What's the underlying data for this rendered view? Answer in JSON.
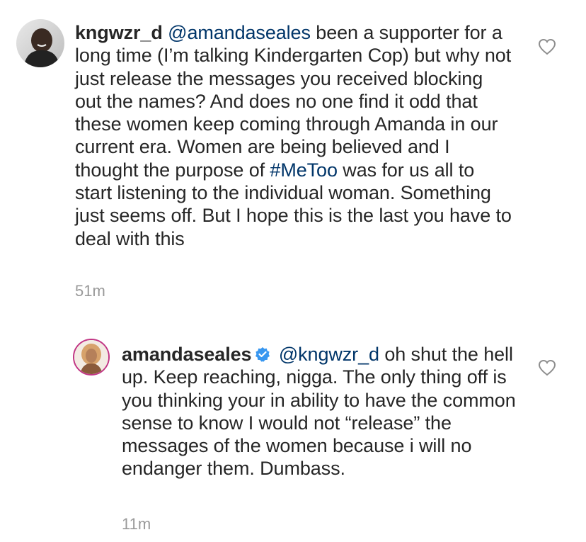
{
  "comments": [
    {
      "username": "kngwzr_d",
      "mention": "@amandaseales",
      "text_before_hashtag": " been a supporter for a long time (I’m talking Kindergarten Cop) but why not just release the messages you received blocking out the names? And does no one find it odd that these women keep coming through Amanda in our current era. Women are being believed and I thought the purpose of ",
      "hashtag": "#MeToo",
      "text_after_hashtag": " was for us all to start listening to the individual woman. Something just seems off. But I hope this is the last you have to deal with this",
      "timestamp": "51m",
      "like_icon": "heart-outline-icon"
    },
    {
      "username": "amandaseales",
      "verified_icon": "verified-badge-icon",
      "mention": "@kngwzr_d",
      "text": " oh shut the hell up. Keep reaching, nigga. The only thing off is you thinking your in ability to have the common sense to know I would not “release” the messages of the women because i will no endanger them. Dumbass.",
      "timestamp": "11m",
      "like_icon": "heart-outline-icon"
    }
  ],
  "colors": {
    "text": "#262626",
    "link": "#003569",
    "timestamp": "#999999",
    "verified": "#3897f0",
    "story_ring": "#c13584"
  }
}
